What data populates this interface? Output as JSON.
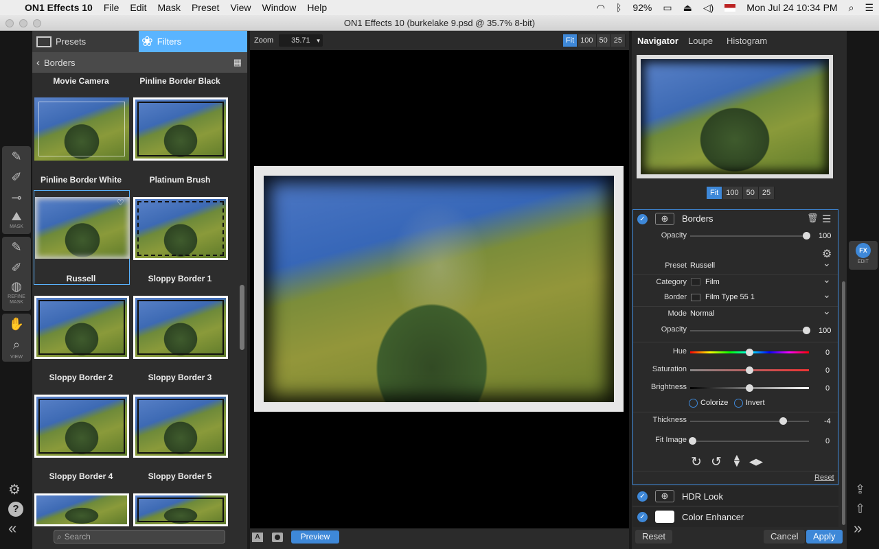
{
  "menubar": {
    "app": "ON1 Effects 10",
    "items": [
      "File",
      "Edit",
      "Mask",
      "Preset",
      "View",
      "Window",
      "Help"
    ],
    "battery": "92%",
    "datetime": "Mon Jul 24  10:34 PM"
  },
  "window": {
    "title": "ON1 Effects 10 (burkelake 9.psd @ 35.7% 8-bit)"
  },
  "lefttools": {
    "mask_label": "MASK",
    "refine_label": "REFINE MASK",
    "view_label": "VIEW"
  },
  "browser": {
    "tabs": [
      "Presets",
      "Filters"
    ],
    "crumb": "Borders",
    "thumbs": [
      {
        "caption_top": "Movie Camera"
      },
      {
        "caption_top": "Pinline Border Black"
      },
      {
        "caption": "Pinline Border White"
      },
      {
        "caption": "Platinum Brush"
      },
      {
        "caption": "Russell"
      },
      {
        "caption": "Sloppy Border 1"
      },
      {
        "caption": "Sloppy Border 2"
      },
      {
        "caption": "Sloppy Border 3"
      },
      {
        "caption": "Sloppy Border 4"
      },
      {
        "caption": "Sloppy Border 5"
      }
    ],
    "search_placeholder": "Search"
  },
  "center": {
    "zoom_label": "Zoom",
    "zoom_value": "35.71",
    "zoom_buttons": [
      "Fit",
      "100",
      "50",
      "25"
    ],
    "preview_label": "Preview"
  },
  "navigator": {
    "tabs": [
      "Navigator",
      "Loupe",
      "Histogram"
    ],
    "zoom_buttons": [
      "Fit",
      "100",
      "50",
      "25"
    ]
  },
  "filter": {
    "name": "Borders",
    "opacity_label": "Opacity",
    "opacity_value": "100",
    "preset_label": "Preset",
    "preset_value": "Russell",
    "category_label": "Category",
    "category_value": "Film",
    "border_label": "Border",
    "border_value": "Film Type 55 1",
    "mode_label": "Mode",
    "mode_value": "Normal",
    "opacity2_label": "Opacity",
    "opacity2_value": "100",
    "hue_label": "Hue",
    "hue_value": "0",
    "sat_label": "Saturation",
    "sat_value": "0",
    "bright_label": "Brightness",
    "bright_value": "0",
    "colorize_label": "Colorize",
    "invert_label": "Invert",
    "thickness_label": "Thickness",
    "thickness_value": "-4",
    "fit_label": "Fit Image",
    "fit_value": "0",
    "reset_link": "Reset"
  },
  "stack": {
    "items": [
      "HDR Look",
      "Color Enhancer"
    ]
  },
  "buttons": {
    "reset": "Reset",
    "cancel": "Cancel",
    "apply": "Apply",
    "edit": "EDIT"
  }
}
